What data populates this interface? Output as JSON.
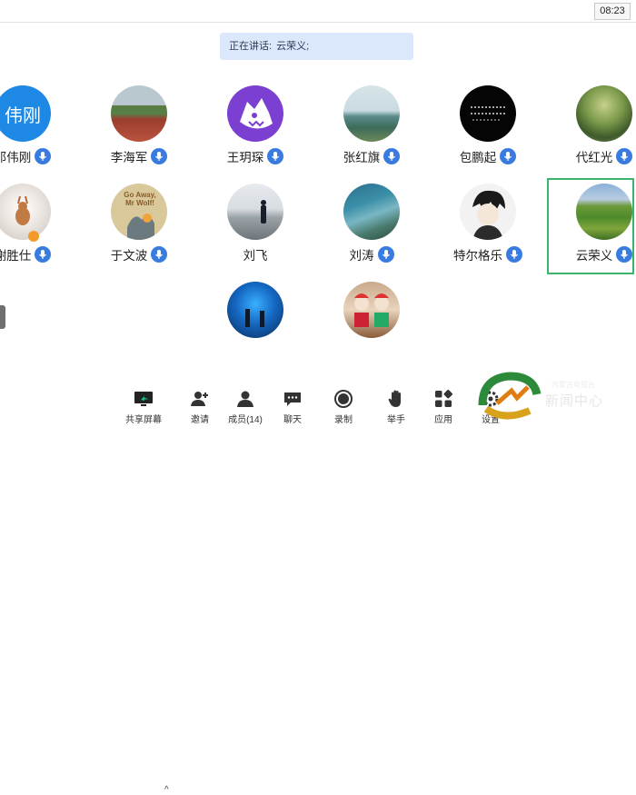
{
  "status": {
    "time": "08:23"
  },
  "speaking": {
    "prefix": "正在讲话:",
    "name": "云荣义;"
  },
  "participants": [
    {
      "name": "邓伟刚",
      "initials": "伟刚",
      "avatar_color": "#1e88e5"
    },
    {
      "name": "李海军",
      "avatar_desc": "track-field"
    },
    {
      "name": "王玥琛",
      "avatar_color": "#7b3fd1",
      "avatar_desc": "cartoon-monster"
    },
    {
      "name": "张红旗",
      "avatar_desc": "seaside-rocks"
    },
    {
      "name": "包鹏起",
      "avatar_desc": "black-calligraphy"
    },
    {
      "name": "代红光",
      "avatar_desc": "tree"
    },
    {
      "name": "谢胜仕",
      "avatar_desc": "deer-globe",
      "host_badge": "person-icon"
    },
    {
      "name": "于文波",
      "avatar_desc": "book-cover",
      "book_text": "Go Away, Mr Wolf!"
    },
    {
      "name": "刘飞",
      "avatar_desc": "man-beach"
    },
    {
      "name": "刘涛",
      "avatar_desc": "coast"
    },
    {
      "name": "特尔格乐",
      "avatar_desc": "anime-boy"
    },
    {
      "name": "云荣义",
      "avatar_desc": "green-field",
      "selected": true
    },
    {
      "name": "",
      "avatar_desc": "aquarium"
    },
    {
      "name": "",
      "avatar_desc": "cartoon-figures"
    }
  ],
  "toolbar": {
    "share": "共享屏幕",
    "invite": "邀请",
    "members": "成员(14)",
    "chat": "聊天",
    "record": "录制",
    "raise_hand": "举手",
    "apps": "应用",
    "settings": "设置"
  },
  "watermark": {
    "text": "新闻中心",
    "subtext": "内蒙古电视台"
  },
  "colors": {
    "accent": "#3a7be0",
    "selected_border": "#3bb56b",
    "speaking_bg": "#dbe8fb"
  }
}
